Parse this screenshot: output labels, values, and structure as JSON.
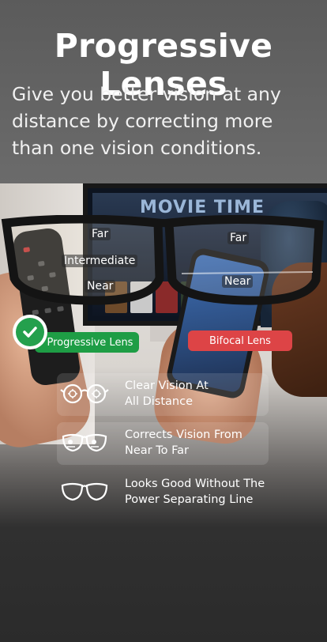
{
  "header": {
    "title": "Progressive Lenses",
    "subtitle": "Give you better vision at any distance by correcting more than one vision conditions."
  },
  "scene": {
    "tv_heading": "MOVIE TIME",
    "progressive_zones": {
      "far": "Far",
      "intermediate": "Intermediate",
      "near": "Near"
    },
    "bifocal_zones": {
      "far": "Far",
      "near": "Near"
    },
    "progressive_badge": "Progressive Lens",
    "bifocal_badge": "Bifocal Lens",
    "colors": {
      "progressive": "#1e9d45",
      "bifocal": "#dd4446"
    }
  },
  "features": [
    {
      "icon": "glasses-focus-icon",
      "text": "Clear Vision At\nAll Distance"
    },
    {
      "icon": "glasses-eyes-icon",
      "text": "Corrects Vision From\nNear To Far"
    },
    {
      "icon": "glasses-icon",
      "text": "Looks Good Without The\nPower Separating Line"
    }
  ]
}
